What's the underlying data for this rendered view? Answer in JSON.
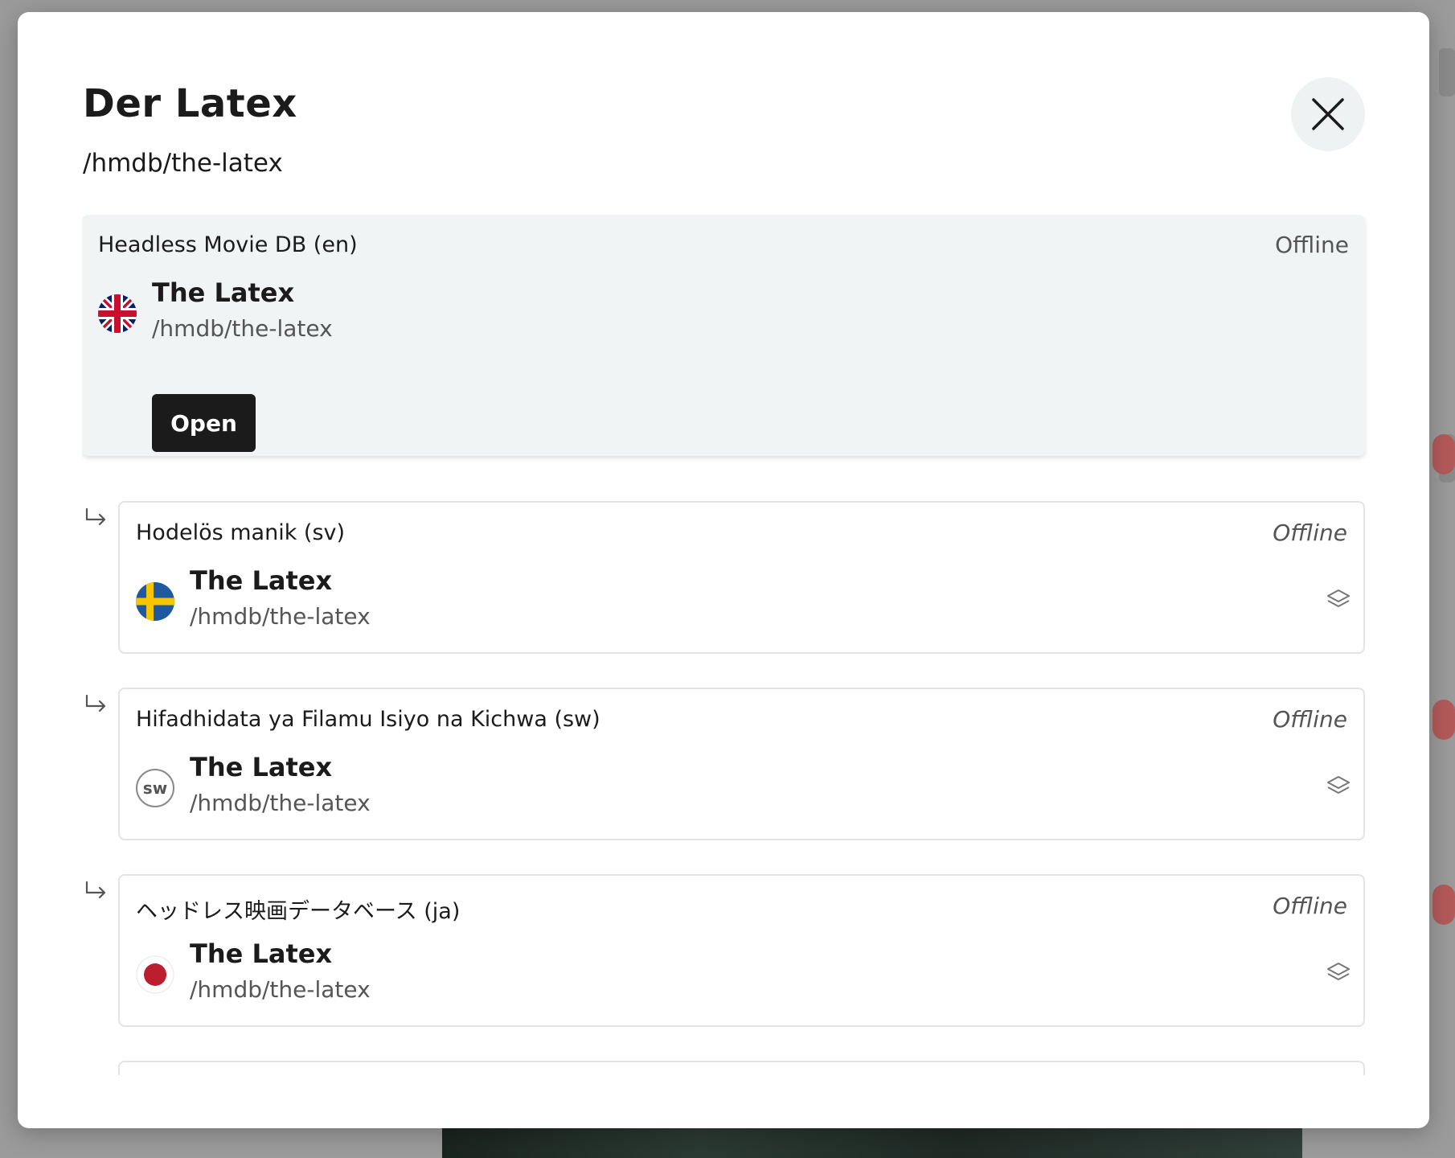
{
  "modal": {
    "title": "Der Latex",
    "path": "/hmdb/the-latex",
    "close_icon": "close-icon"
  },
  "source": {
    "site": "Headless Movie DB (en)",
    "status": "Offline",
    "flag": "uk-flag-icon",
    "title": "The Latex",
    "path": "/hmdb/the-latex",
    "open_label": "Open"
  },
  "variants": [
    {
      "site": "Hodelös manik (sv)",
      "status": "Offline",
      "flag": "sweden-flag-icon",
      "title": "The Latex",
      "path": "/hmdb/the-latex"
    },
    {
      "site": "Hifadhidata ya Filamu Isiyo na Kichwa (sw)",
      "status": "Offline",
      "badge": "sw",
      "title": "The Latex",
      "path": "/hmdb/the-latex"
    },
    {
      "site": "ヘッドレス映画データベース (ja)",
      "status": "Offline",
      "flag": "japan-flag-icon",
      "title": "The Latex",
      "path": "/hmdb/the-latex"
    }
  ],
  "colors": {
    "primary_button": "#1b1b1b",
    "source_card_bg": "#f0f4f5",
    "close_button_bg": "#eef2f3"
  }
}
